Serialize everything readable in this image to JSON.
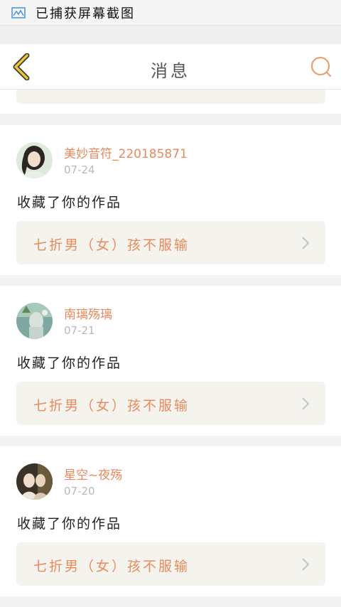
{
  "status_bar": {
    "text": "已捕获屏幕截图",
    "icon": "screenshot-icon"
  },
  "header": {
    "title": "消息",
    "back_icon": "chevron-left-icon",
    "search_icon": "search-icon"
  },
  "colors": {
    "accent": "#e8885c",
    "back_arrow": "#e8c43a",
    "card_box": "#f4f3ee"
  },
  "messages": [
    {
      "username": "美妙音符_220185871",
      "date": "07-24",
      "action": "收藏了你的作品",
      "work_title": "七折男（女）孩不服输"
    },
    {
      "username": "南璃殇璃",
      "date": "07-21",
      "action": "收藏了你的作品",
      "work_title": "七折男（女）孩不服输"
    },
    {
      "username": "星空~夜殇",
      "date": "07-20",
      "action": "收藏了你的作品",
      "work_title": "七折男（女）孩不服输"
    }
  ]
}
